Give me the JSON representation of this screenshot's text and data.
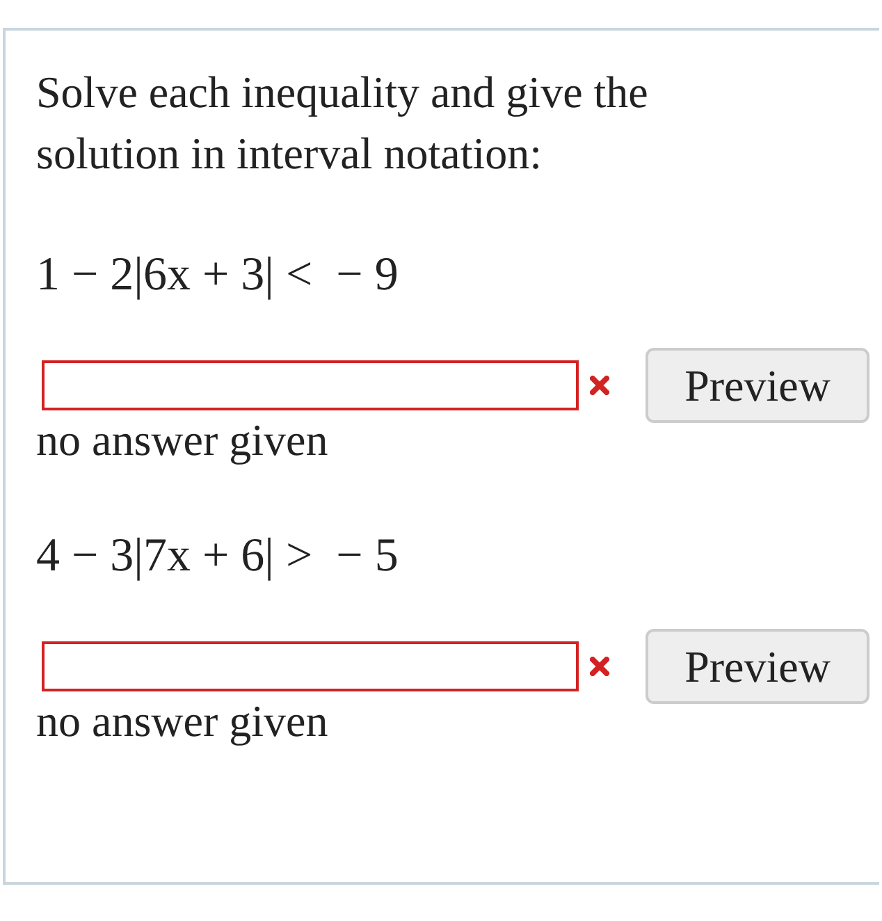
{
  "instructions": "Solve each inequality and give the solution in interval notation:",
  "problems": [
    {
      "expression": "1 − 2|6x + 3| <  − 9",
      "answer_field": {
        "error": true
      },
      "feedback": "no answer given",
      "button": "Preview"
    },
    {
      "expression": "4 − 3|7x + 6| >  − 5",
      "answer_field": {
        "error": true
      },
      "feedback": "no answer given",
      "button": "Preview"
    }
  ]
}
